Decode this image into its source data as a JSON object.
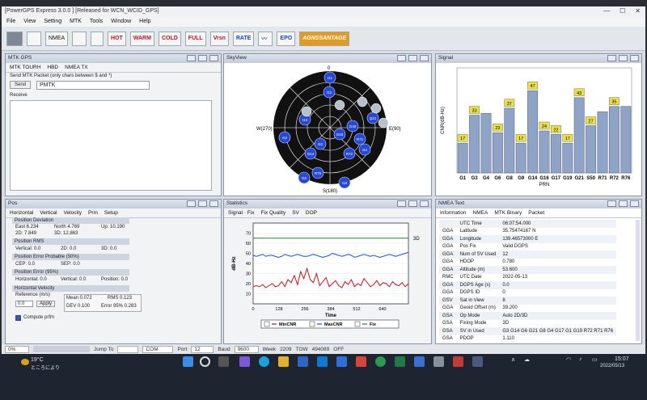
{
  "app": {
    "title": "[PowerGPS Express 3.0.0 ] [Released for WCN_WCID_GPS]",
    "menu": [
      "File",
      "View",
      "Setting",
      "MTK",
      "Tools",
      "Window",
      "Help"
    ],
    "toolbar": [
      "NMEA",
      "HOT",
      "WARM",
      "COLD",
      "FULL",
      "Vrsn",
      "RATE",
      "EPO",
      "AGNSSANTAGE"
    ]
  },
  "mtk_panel": {
    "title": "MTK GPS",
    "tabs": [
      "MTK TOURH",
      "HBD",
      "NMEA TX"
    ],
    "hint": "Send MTK Packet (only chars between $ and *)",
    "send_label": "Send",
    "packet_value": "PMTK",
    "receive_label": "Receive"
  },
  "sky_panel": {
    "title": "SkyView",
    "north": "0",
    "east": "E(90)",
    "south": "S(180)",
    "west": "W(270)",
    "sats": [
      "I11",
      "I12",
      "Q21",
      "G18",
      "R71",
      "G16",
      "I13",
      "G14",
      "I10",
      "R72",
      "G4",
      "G2",
      "I18",
      "G6",
      "R76"
    ]
  },
  "signal_panel": {
    "title": "Signal",
    "ylabel": "CNR(dB-Hz)",
    "xlabel": "PRN"
  },
  "chart_data": [
    {
      "type": "bar",
      "title": "",
      "xlabel": "PRN",
      "ylabel": "CNR(dB-Hz)",
      "categories": [
        "G1",
        "G3",
        "G4",
        "G6",
        "G8",
        "G9",
        "G14",
        "G16",
        "G17",
        "G19",
        "G21",
        "S50",
        "R71",
        "R72",
        "R76"
      ],
      "values": [
        17,
        33,
        34,
        23,
        37,
        17,
        47,
        24,
        22,
        17,
        43,
        27,
        35,
        38,
        38
      ],
      "value_labels": [
        "17",
        "33",
        "",
        "23",
        "37",
        "17",
        "47",
        "24",
        "22",
        "17",
        "43",
        "27",
        "",
        "35",
        ""
      ],
      "ylim": [
        0,
        60
      ],
      "bar_color": "#8fa3c6",
      "label_color": "#e9e04a"
    },
    {
      "type": "line",
      "title": "",
      "xlabel": "Time",
      "ylabel": "dB-Hz",
      "xlim": [
        0,
        768
      ],
      "ylim": [
        0,
        80
      ],
      "x_ticks": [
        0,
        128,
        256,
        384,
        512,
        640
      ],
      "y_ticks": [
        10,
        20,
        30,
        40,
        50,
        60,
        70
      ],
      "annotation": "3D",
      "series": [
        {
          "name": "MinCNR",
          "color": "#c1121f",
          "values": [
            17,
            18,
            17,
            19,
            16,
            18,
            20,
            17,
            18,
            22,
            17,
            24,
            21,
            28,
            19,
            32,
            25,
            35,
            24,
            21,
            30,
            18,
            22,
            26,
            17,
            20,
            23,
            18,
            16,
            22,
            19,
            24,
            17,
            20,
            18,
            25,
            21,
            17,
            19,
            23,
            18,
            21,
            20,
            17,
            22,
            19,
            18,
            21,
            17,
            20
          ]
        },
        {
          "name": "MaxCNR",
          "color": "#1f52d4",
          "values": [
            48,
            47,
            48,
            49,
            47,
            48,
            48,
            47,
            46,
            47,
            49,
            48,
            47,
            48,
            49,
            48,
            47,
            47,
            48,
            49,
            48,
            47,
            46,
            47,
            48,
            50,
            49,
            48,
            47,
            48,
            49,
            48,
            46,
            47,
            48,
            49,
            48,
            47,
            48,
            47,
            46,
            47,
            48,
            49,
            48,
            47,
            48,
            49,
            50,
            51
          ]
        },
        {
          "name": "Fix",
          "color": "#2e7d32",
          "values": [
            65,
            65,
            65,
            65,
            65,
            65,
            65,
            65,
            65,
            65,
            65,
            65,
            65,
            65,
            65,
            65,
            65,
            65,
            65,
            65,
            65,
            65,
            65,
            65,
            65,
            65,
            65,
            65,
            65,
            65,
            65,
            65,
            65,
            65,
            65,
            65,
            65,
            65,
            65,
            65,
            65,
            65,
            65,
            65,
            65,
            65,
            65,
            65,
            65,
            65
          ]
        }
      ]
    }
  ],
  "stats_panel": {
    "title": "Statistics",
    "tabs": [
      "Signal · Fix",
      "Fix Quality",
      "SV",
      "DOP"
    ]
  },
  "nmea_panel": {
    "title": "NMEA Text",
    "tabs": [
      "Information",
      "NMEA",
      "MTK Binary",
      "Packet"
    ],
    "rows": [
      [
        "",
        "UTC Time",
        "06:07:54.000"
      ],
      [
        "GGA",
        "Latitude",
        "35.75474167 N"
      ],
      [
        "GGA",
        "Longitude",
        "139.46573000 E"
      ],
      [
        "GGA",
        "Pos Fix",
        "Valid DGPS"
      ],
      [
        "GGA",
        "Num of SV Used",
        "12"
      ],
      [
        "GGA",
        "HDOP",
        "0.780"
      ],
      [
        "GGA",
        "Altitude (m)",
        "53.600"
      ],
      [
        "RMC",
        "UTC Date",
        "2022-05-13"
      ],
      [
        "GGA",
        "DGPS Age (s)",
        "0.0"
      ],
      [
        "GGA",
        "DGPS ID",
        "0"
      ],
      [
        "GSV",
        "Sat in View",
        "8"
      ],
      [
        "GGA",
        "Geoid Offset (m)",
        "39.200"
      ],
      [
        "GSA",
        "Op Mode",
        "Auto 2D/3D"
      ],
      [
        "GSA",
        "Fixing Mode",
        "3D"
      ],
      [
        "GSA",
        "SV in Used",
        "G3 G14 G6 G21 G8 G4 G17 G1 G19 R72 R71 R76"
      ],
      [
        "GSA",
        "PDOP",
        "1.110"
      ]
    ]
  },
  "pos_panel": {
    "title": "Pos",
    "tabs": [
      "Horizontal",
      "Vertical",
      "Velocity",
      "Prm",
      "Setup"
    ],
    "pos_dev": "Position Deviation",
    "east": "East 6.234",
    "north": "North 4.769",
    "up": "Up: 10.190",
    "d2": "2D:  7.849",
    "d3": "3D:  12.863",
    "rms_title": "Position RMS",
    "rms_vert": "Vertical: 0.0",
    "rms_2d": "2D: 0.0",
    "rms_3d": "3D: 0.0",
    "cep_title": "Position Error Probable (50%)",
    "cep": "CEP: 0.0",
    "sep": "SEP: 0.0",
    "err95_title": "Position Error (95%)",
    "h95": "Horizontal: 0.0",
    "v95": "Vertical: 0.0",
    "p95": "Position: 0.0",
    "hvel_title": "Horizontal Velocity",
    "ref_label": "Reference (m/s)",
    "ref_val": "0.0",
    "apply": "Apply",
    "mean": "Mean   0.072",
    "rms": "RMS    0.123",
    "dev": "DEV    0.100",
    "err95": "Error 95%  0.283",
    "compute": "Compute prfm"
  },
  "status": {
    "progress": "0%",
    "jump": "Jump To",
    "com": "COM",
    "port_label": "Port",
    "port_val": "12",
    "baud_label": "Baud",
    "baud_val": "9600",
    "week": "Week",
    "week_val": "2209",
    "tow": "TOW",
    "tow_val": "494089",
    "off": "OFF"
  },
  "taskbar": {
    "weather_temp": "19°C",
    "weather_desc": "ところにより",
    "time": "15:07",
    "date": "2022/05/13"
  }
}
